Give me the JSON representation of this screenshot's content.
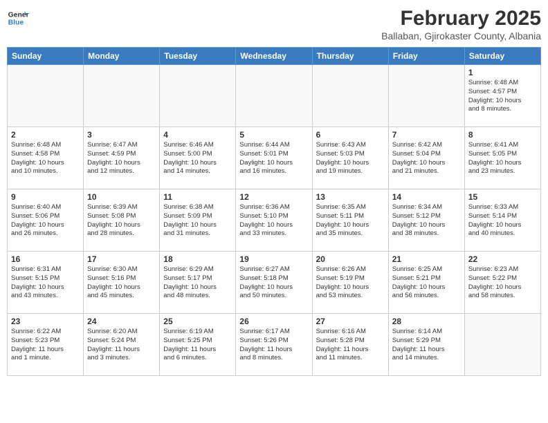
{
  "header": {
    "logo_general": "General",
    "logo_blue": "Blue",
    "month_title": "February 2025",
    "location": "Ballaban, Gjirokaster County, Albania"
  },
  "weekdays": [
    "Sunday",
    "Monday",
    "Tuesday",
    "Wednesday",
    "Thursday",
    "Friday",
    "Saturday"
  ],
  "days": [
    {
      "day": "",
      "info": ""
    },
    {
      "day": "",
      "info": ""
    },
    {
      "day": "",
      "info": ""
    },
    {
      "day": "",
      "info": ""
    },
    {
      "day": "",
      "info": ""
    },
    {
      "day": "",
      "info": ""
    },
    {
      "day": "1",
      "info": "Sunrise: 6:48 AM\nSunset: 4:57 PM\nDaylight: 10 hours\nand 8 minutes."
    },
    {
      "day": "2",
      "info": "Sunrise: 6:48 AM\nSunset: 4:58 PM\nDaylight: 10 hours\nand 10 minutes."
    },
    {
      "day": "3",
      "info": "Sunrise: 6:47 AM\nSunset: 4:59 PM\nDaylight: 10 hours\nand 12 minutes."
    },
    {
      "day": "4",
      "info": "Sunrise: 6:46 AM\nSunset: 5:00 PM\nDaylight: 10 hours\nand 14 minutes."
    },
    {
      "day": "5",
      "info": "Sunrise: 6:44 AM\nSunset: 5:01 PM\nDaylight: 10 hours\nand 16 minutes."
    },
    {
      "day": "6",
      "info": "Sunrise: 6:43 AM\nSunset: 5:03 PM\nDaylight: 10 hours\nand 19 minutes."
    },
    {
      "day": "7",
      "info": "Sunrise: 6:42 AM\nSunset: 5:04 PM\nDaylight: 10 hours\nand 21 minutes."
    },
    {
      "day": "8",
      "info": "Sunrise: 6:41 AM\nSunset: 5:05 PM\nDaylight: 10 hours\nand 23 minutes."
    },
    {
      "day": "9",
      "info": "Sunrise: 6:40 AM\nSunset: 5:06 PM\nDaylight: 10 hours\nand 26 minutes."
    },
    {
      "day": "10",
      "info": "Sunrise: 6:39 AM\nSunset: 5:08 PM\nDaylight: 10 hours\nand 28 minutes."
    },
    {
      "day": "11",
      "info": "Sunrise: 6:38 AM\nSunset: 5:09 PM\nDaylight: 10 hours\nand 31 minutes."
    },
    {
      "day": "12",
      "info": "Sunrise: 6:36 AM\nSunset: 5:10 PM\nDaylight: 10 hours\nand 33 minutes."
    },
    {
      "day": "13",
      "info": "Sunrise: 6:35 AM\nSunset: 5:11 PM\nDaylight: 10 hours\nand 35 minutes."
    },
    {
      "day": "14",
      "info": "Sunrise: 6:34 AM\nSunset: 5:12 PM\nDaylight: 10 hours\nand 38 minutes."
    },
    {
      "day": "15",
      "info": "Sunrise: 6:33 AM\nSunset: 5:14 PM\nDaylight: 10 hours\nand 40 minutes."
    },
    {
      "day": "16",
      "info": "Sunrise: 6:31 AM\nSunset: 5:15 PM\nDaylight: 10 hours\nand 43 minutes."
    },
    {
      "day": "17",
      "info": "Sunrise: 6:30 AM\nSunset: 5:16 PM\nDaylight: 10 hours\nand 45 minutes."
    },
    {
      "day": "18",
      "info": "Sunrise: 6:29 AM\nSunset: 5:17 PM\nDaylight: 10 hours\nand 48 minutes."
    },
    {
      "day": "19",
      "info": "Sunrise: 6:27 AM\nSunset: 5:18 PM\nDaylight: 10 hours\nand 50 minutes."
    },
    {
      "day": "20",
      "info": "Sunrise: 6:26 AM\nSunset: 5:19 PM\nDaylight: 10 hours\nand 53 minutes."
    },
    {
      "day": "21",
      "info": "Sunrise: 6:25 AM\nSunset: 5:21 PM\nDaylight: 10 hours\nand 56 minutes."
    },
    {
      "day": "22",
      "info": "Sunrise: 6:23 AM\nSunset: 5:22 PM\nDaylight: 10 hours\nand 58 minutes."
    },
    {
      "day": "23",
      "info": "Sunrise: 6:22 AM\nSunset: 5:23 PM\nDaylight: 11 hours\nand 1 minute."
    },
    {
      "day": "24",
      "info": "Sunrise: 6:20 AM\nSunset: 5:24 PM\nDaylight: 11 hours\nand 3 minutes."
    },
    {
      "day": "25",
      "info": "Sunrise: 6:19 AM\nSunset: 5:25 PM\nDaylight: 11 hours\nand 6 minutes."
    },
    {
      "day": "26",
      "info": "Sunrise: 6:17 AM\nSunset: 5:26 PM\nDaylight: 11 hours\nand 8 minutes."
    },
    {
      "day": "27",
      "info": "Sunrise: 6:16 AM\nSunset: 5:28 PM\nDaylight: 11 hours\nand 11 minutes."
    },
    {
      "day": "28",
      "info": "Sunrise: 6:14 AM\nSunset: 5:29 PM\nDaylight: 11 hours\nand 14 minutes."
    },
    {
      "day": "",
      "info": ""
    }
  ]
}
